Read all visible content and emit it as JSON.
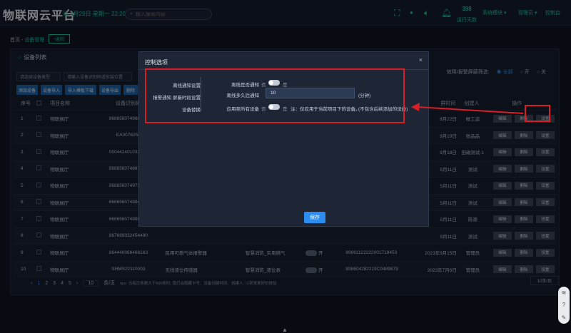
{
  "header": {
    "title": "物联网云平台",
    "datetime": "4月29日 星期一 22:20:16",
    "search_placeholder": "输入搜索内容",
    "run_days_value": "398",
    "run_days_label": "运行天数",
    "system_module": "系统模块",
    "admin": "管理员",
    "console": "控制台"
  },
  "breadcrumb": {
    "home": "首页",
    "sep": " - ",
    "current": "设备管理",
    "back": "返回"
  },
  "panel": {
    "title": "设备列表",
    "filter_type": "请选择设备类型",
    "filter_search": "请输入设备识别码或安装位置",
    "buttons": [
      "添加设备",
      "设备导入",
      "导入模板下载",
      "设备导出",
      "删除"
    ],
    "radio_label": "故障/报警屏蔽筛选:",
    "radio_all": "全部",
    "radio_on": "开",
    "radio_off": "关"
  },
  "table": {
    "headers": {
      "no": "序号",
      "name": "项目名称",
      "code": "设备识别码",
      "date": "屏时间",
      "creator": "创建人",
      "ops": "操作"
    },
    "ops_labels": {
      "edit": "编辑",
      "delete": "删除",
      "settings": "设置"
    },
    "rows": [
      {
        "no": "1",
        "name": "物联展厅",
        "code": "868656074960816",
        "mid": "",
        "type": "",
        "switch": "",
        "card": "",
        "date": "8月22日",
        "creator": "帐工运"
      },
      {
        "no": "2",
        "name": "物联展厅",
        "code": "EA0076254",
        "mid": "",
        "type": "",
        "switch": "",
        "card": "",
        "date": "9月19日",
        "creator": "张品品"
      },
      {
        "no": "3",
        "name": "物联展厅",
        "code": "000442401033007",
        "mid": "",
        "type": "",
        "switch": "",
        "card": "",
        "date": "9月18日",
        "creator": "田磁测试-1"
      },
      {
        "no": "4",
        "name": "物联展厅",
        "code": "868656074887068",
        "mid": "",
        "type": "",
        "switch": "",
        "card": "",
        "date": "5月11日",
        "creator": "测试"
      },
      {
        "no": "5",
        "name": "物联展厅",
        "code": "868656074973561",
        "mid": "",
        "type": "",
        "switch": "",
        "card": "",
        "date": "5月11日",
        "creator": "测试"
      },
      {
        "no": "6",
        "name": "物联展厅",
        "code": "868656074984471",
        "mid": "",
        "type": "",
        "switch": "",
        "card": "",
        "date": "5月11日",
        "creator": "测试"
      },
      {
        "no": "7",
        "name": "物联展厅",
        "code": "868656074980384",
        "mid": "",
        "type": "",
        "switch": "",
        "card": "",
        "date": "5月11日",
        "creator": "陈源"
      },
      {
        "no": "8",
        "name": "物联展厅",
        "code": "867689032454490",
        "mid": "",
        "type": "",
        "switch": "",
        "card": "",
        "date": "9月11日",
        "creator": "测试"
      },
      {
        "no": "9",
        "name": "物联展厅",
        "code": "864440066466163",
        "mid": "民用可燃气体报警器",
        "type": "智慧消防_实用燃气",
        "switch": "开",
        "card": "89861122222001718453",
        "date": "2023年9月15日",
        "creator": "管理员"
      },
      {
        "no": "10",
        "name": "物联展厅",
        "code": "SHMS22110003",
        "mid": "无线液位传感器",
        "type": "智慧消防_液位表",
        "switch": "开",
        "card": "898604282219C0489879",
        "date": "2023年7月6日",
        "creator": "管理员"
      }
    ]
  },
  "pagination": {
    "pages": [
      "1",
      "2",
      "3",
      "4",
      "5"
    ],
    "page_input": "10",
    "page_unit": "条/页",
    "tip": "tips: 当每页条数大于600条时, 我们会隐藏卡号、设备创建时间、创建人, 以带来更好的体验",
    "page_size": "10条/页"
  },
  "dialog": {
    "title": "控制选项",
    "close": "×",
    "nav": [
      "离线通知设置",
      "报警通知 屏蔽时段设置",
      "设备替换"
    ],
    "offline_notify_label": "离线是否通知",
    "offline_after_label": "离线多久后通知",
    "offline_after_value": "10",
    "offline_after_unit": "(分钟)",
    "apply_all_label": "应用至所有设备",
    "yes": "否",
    "no": "是",
    "note1": "注：仅应用于当前项目下的设备。",
    "note2": "(不包含后续添加的设备)",
    "save": "保存"
  },
  "colors": {
    "accent": "#19c4a8",
    "primary": "#2d8cf0",
    "annotation": "#d61f26"
  }
}
